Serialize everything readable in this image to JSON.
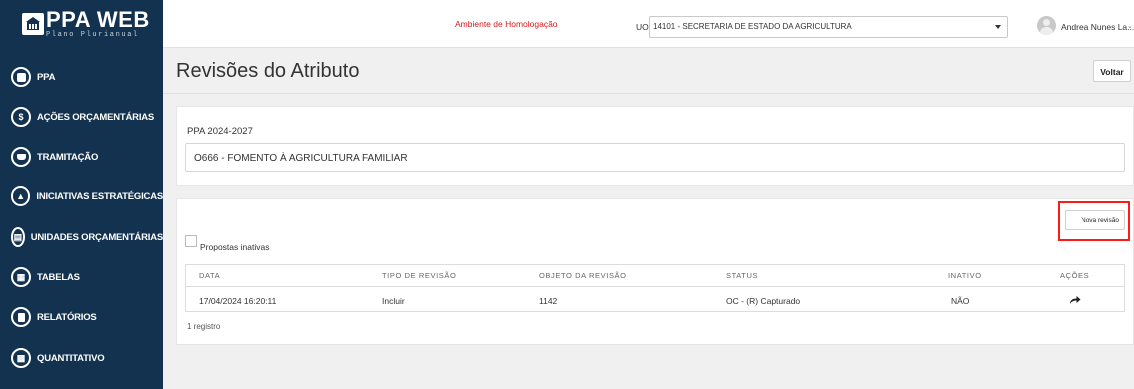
{
  "brand": {
    "name": "PPA WEB",
    "subtitle": "Plano Plurianual"
  },
  "sidebar": {
    "items": [
      {
        "label": "PPA",
        "icon": "book-icon"
      },
      {
        "label": "AÇÕES ORÇAMENTÁRIAS",
        "icon": "dollar-icon"
      },
      {
        "label": "TRAMITAÇÃO",
        "icon": "inbox-icon"
      },
      {
        "label": "INICIATIVAS ESTRATÉGICAS",
        "icon": "sitemap-icon"
      },
      {
        "label": "UNIDADES ORÇAMENTÁRIAS",
        "icon": "bank-icon"
      },
      {
        "label": "TABELAS",
        "icon": "table-icon"
      },
      {
        "label": "RELATÓRIOS",
        "icon": "file-icon"
      },
      {
        "label": "QUANTITATIVO",
        "icon": "chart-icon"
      }
    ]
  },
  "topbar": {
    "environment": "Ambiente de Homologação",
    "uo_label": "UO:",
    "uo_value": "14101 - SECRETARIA DE ESTADO DA AGRICULTURA",
    "user_name": "Andrea Nunes La...",
    "user_caret": "⌄"
  },
  "page": {
    "title": "Revisões do Atributo",
    "back_button": "Voltar"
  },
  "program": {
    "ppa": "PPA 2024-2027",
    "name": "O666 - FOMENTO À AGRICULTURA FAMILIAR"
  },
  "revisions": {
    "new_button": "Nova revisão",
    "inactive_checkbox_label": "Propostas inativas",
    "columns": [
      "DATA",
      "TIPO DE REVISÃO",
      "OBJETO DA REVISÃO",
      "STATUS",
      "INATIVO",
      "AÇÕES"
    ],
    "rows": [
      {
        "data": "17/04/2024 16:20:11",
        "tipo": "Incluir",
        "objeto": "1142",
        "status": "OC - (R) Capturado",
        "inativo": "NÃO"
      }
    ],
    "count": "1 registro"
  },
  "colors": {
    "sidebar": "#13324f",
    "accent_red": "#d7191c",
    "highlight": "#ff1a1a"
  }
}
